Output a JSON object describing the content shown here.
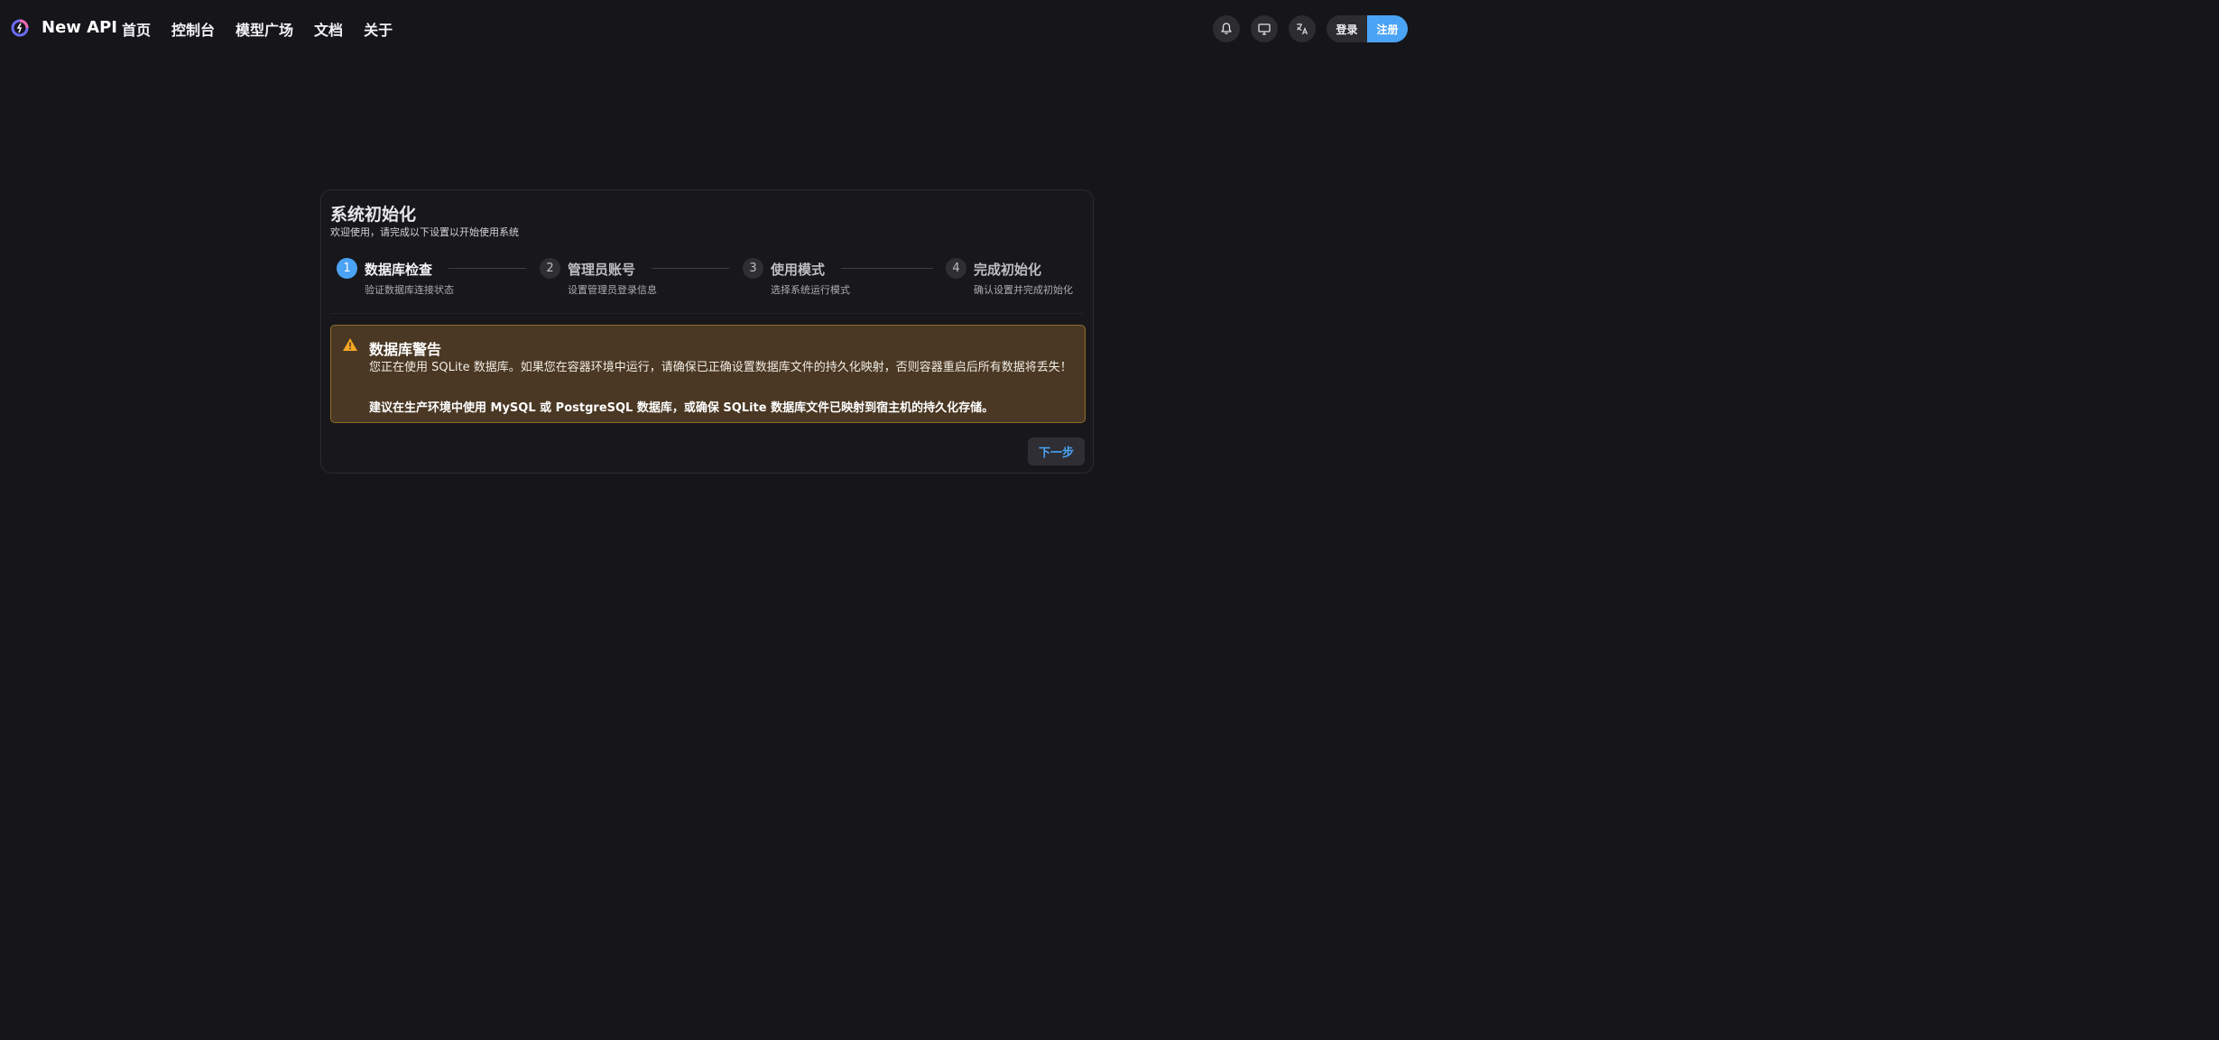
{
  "header": {
    "brand": "New API",
    "nav": [
      "首页",
      "控制台",
      "模型广场",
      "文档",
      "关于"
    ],
    "icons": [
      "bell-icon",
      "monitor-icon",
      "translate-icon"
    ],
    "login_label": "登录",
    "register_label": "注册"
  },
  "setup": {
    "title": "系统初始化",
    "subtitle": "欢迎使用，请完成以下设置以开始使用系统",
    "steps": [
      {
        "num": "1",
        "title": "数据库检查",
        "desc": "验证数据库连接状态"
      },
      {
        "num": "2",
        "title": "管理员账号",
        "desc": "设置管理员登录信息"
      },
      {
        "num": "3",
        "title": "使用模式",
        "desc": "选择系统运行模式"
      },
      {
        "num": "4",
        "title": "完成初始化",
        "desc": "确认设置并完成初始化"
      }
    ],
    "current_step": 1,
    "warning": {
      "title": "数据库警告",
      "text": "您正在使用 SQLite 数据库。如果您在容器环境中运行，请确保已正确设置数据库文件的持久化映射，否则容器重启后所有数据将丢失！",
      "emphasis": "建议在生产环境中使用 MySQL 或 PostgreSQL 数据库，或确保 SQLite 数据库文件已映射到宿主机的持久化存储。"
    },
    "next_label": "下一步"
  },
  "colors": {
    "background": "#16161a",
    "accent": "#4ba3f5",
    "warning_bg": "#4a3824",
    "warning_border": "#8d6d2a",
    "warning_icon": "#f5a623"
  }
}
